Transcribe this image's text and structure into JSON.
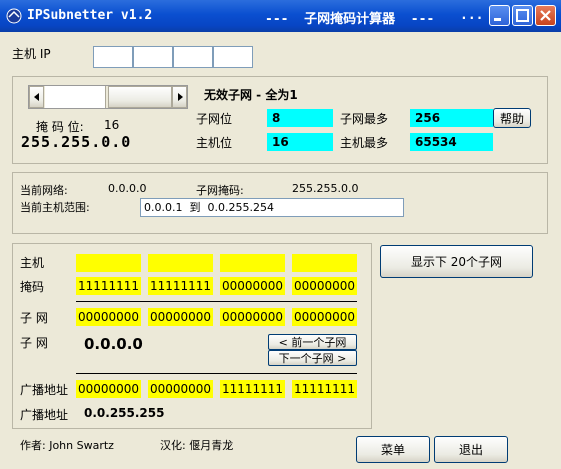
{
  "titlebar": {
    "app_title": "IPSubnetter v1.2",
    "subtitle": "---  子网掩码计算器  ---",
    "dots": "..."
  },
  "host_ip": {
    "label": "主机 IP",
    "octets": [
      "",
      "",
      "",
      ""
    ]
  },
  "mask_section": {
    "heading": "无效子网 - 全为1",
    "mask_bits_label": "掩 码 位:",
    "mask_bits_value": "16",
    "mask_value": "255.255.0.0",
    "subnet_bits_label": "子网位",
    "subnet_bits_value": "8",
    "host_bits_label": "主机位",
    "host_bits_value": "16",
    "max_subnets_label": "子网最多",
    "max_subnets_value": "256",
    "max_hosts_label": "主机最多",
    "max_hosts_value": "65534",
    "help_button": "帮助"
  },
  "network_section": {
    "current_network_label": "当前网络:",
    "current_network_value": "0.0.0.0",
    "subnet_mask_label": "子网掩码:",
    "subnet_mask_value": "255.255.0.0",
    "host_range_label": "当前主机范围:",
    "host_range_value": "0.0.0.1  到  0.0.255.254"
  },
  "binary_section": {
    "host_label": "主机",
    "host_bits": [
      "",
      "",
      "",
      ""
    ],
    "mask_label": "掩码",
    "mask_bits": [
      "11111111",
      "11111111",
      "00000000",
      "00000000"
    ],
    "subnet_label": "子  网",
    "subnet_bits": [
      "00000000",
      "00000000",
      "00000000",
      "00000000"
    ],
    "subnet_label2": "子  网",
    "subnet_value": "0.0.0.0",
    "prev_subnet_button": "< 前一个子网",
    "next_subnet_button": "下一个子网 >",
    "broadcast_label": "广播地址",
    "broadcast_bits": [
      "00000000",
      "00000000",
      "11111111",
      "11111111"
    ],
    "broadcast_label2": "广播地址",
    "broadcast_value": "0.0.255.255"
  },
  "show_next_button": "显示下 20个子网",
  "footer": {
    "author": "作者: John Swartz",
    "localizer": "汉化: 偃月青龙",
    "menu_button": "菜单",
    "exit_button": "退出"
  },
  "colors": {
    "titlebar": "#0a4fd0",
    "window_bg": "#ece9d8",
    "cyan_field": "#00ffff",
    "yellow_field": "#ffff00"
  }
}
